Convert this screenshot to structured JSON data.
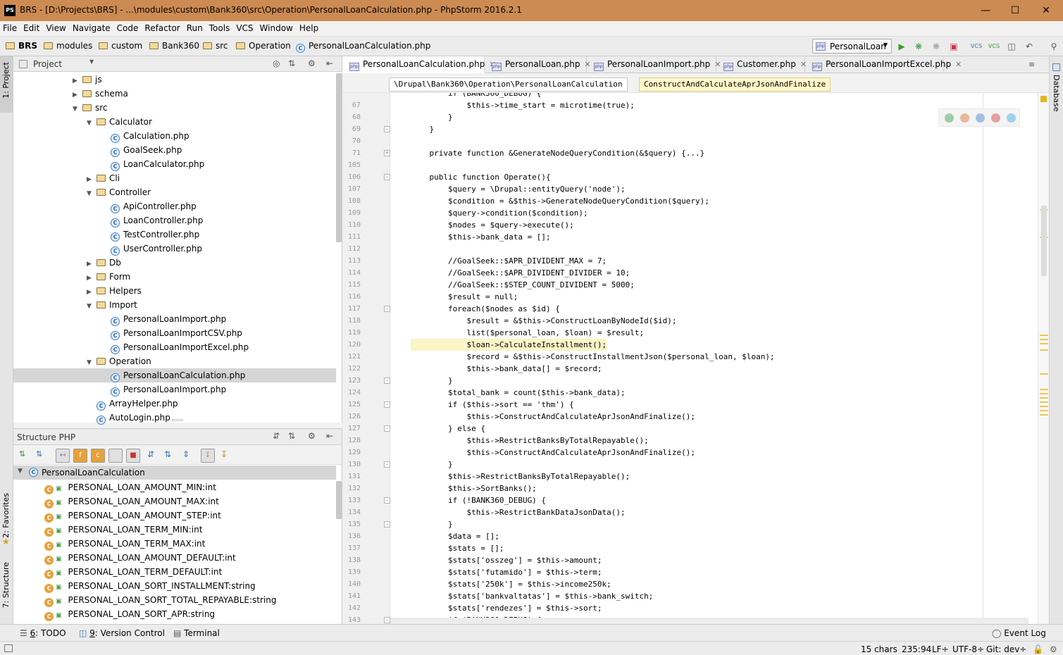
{
  "window": {
    "title": "BRS - [D:\\Projects\\BRS] - ...\\modules\\custom\\Bank360\\src\\Operation\\PersonalLoanCalculation.php - PhpStorm 2016.2.1",
    "logo": "PS"
  },
  "menu": [
    "File",
    "Edit",
    "View",
    "Navigate",
    "Code",
    "Refactor",
    "Run",
    "Tools",
    "VCS",
    "Window",
    "Help"
  ],
  "breadcrumbs": [
    "BRS",
    "modules",
    "custom",
    "Bank360",
    "src",
    "Operation",
    "PersonalLoanCalculation.php"
  ],
  "run_config": "PersonalLoan",
  "toolwindows": {
    "project": "1: Project",
    "favorites": "2: Favorites",
    "structure": "7: Structure",
    "database": "Database"
  },
  "project_panel": {
    "title": "Project",
    "rows": [
      {
        "label": "js",
        "type": "folder",
        "depth": 0,
        "arrow": "collapsed"
      },
      {
        "label": "schema",
        "type": "folder",
        "depth": 0,
        "arrow": "collapsed"
      },
      {
        "label": "src",
        "type": "folder",
        "depth": 0,
        "arrow": "expanded"
      },
      {
        "label": "Calculator",
        "type": "folder",
        "depth": 1,
        "arrow": "expanded"
      },
      {
        "label": "Calculation.php",
        "type": "class",
        "depth": 2
      },
      {
        "label": "GoalSeek.php",
        "type": "class",
        "depth": 2
      },
      {
        "label": "LoanCalculator.php",
        "type": "class",
        "depth": 2
      },
      {
        "label": "Cli",
        "type": "folder",
        "depth": 1,
        "arrow": "collapsed"
      },
      {
        "label": "Controller",
        "type": "folder",
        "depth": 1,
        "arrow": "expanded"
      },
      {
        "label": "ApiController.php",
        "type": "class",
        "depth": 2
      },
      {
        "label": "LoanController.php",
        "type": "class",
        "depth": 2
      },
      {
        "label": "TestController.php",
        "type": "class",
        "depth": 2
      },
      {
        "label": "UserController.php",
        "type": "class",
        "depth": 2
      },
      {
        "label": "Db",
        "type": "folder",
        "depth": 1,
        "arrow": "collapsed"
      },
      {
        "label": "Form",
        "type": "folder",
        "depth": 1,
        "arrow": "collapsed"
      },
      {
        "label": "Helpers",
        "type": "folder",
        "depth": 1,
        "arrow": "collapsed"
      },
      {
        "label": "Import",
        "type": "folder",
        "depth": 1,
        "arrow": "expanded"
      },
      {
        "label": "PersonalLoanImport.php",
        "type": "class",
        "depth": 2
      },
      {
        "label": "PersonalLoanImportCSV.php",
        "type": "class",
        "depth": 2
      },
      {
        "label": "PersonalLoanImportExcel.php",
        "type": "class",
        "depth": 2
      },
      {
        "label": "Operation",
        "type": "folder",
        "depth": 1,
        "arrow": "expanded"
      },
      {
        "label": "PersonalLoanCalculation.php",
        "type": "class",
        "depth": 2,
        "selected": true
      },
      {
        "label": "PersonalLoanImport.php",
        "type": "class",
        "depth": 2
      },
      {
        "label": "ArrayHelper.php",
        "type": "class",
        "depth": 1
      },
      {
        "label": "AutoLogin.php",
        "type": "class",
        "depth": 1
      }
    ]
  },
  "structure_panel": {
    "title": "Structure PHP",
    "root": "PersonalLoanCalculation",
    "items": [
      "PERSONAL_LOAN_AMOUNT_MIN:int",
      "PERSONAL_LOAN_AMOUNT_MAX:int",
      "PERSONAL_LOAN_AMOUNT_STEP:int",
      "PERSONAL_LOAN_TERM_MIN:int",
      "PERSONAL_LOAN_TERM_MAX:int",
      "PERSONAL_LOAN_AMOUNT_DEFAULT:int",
      "PERSONAL_LOAN_TERM_DEFAULT:int",
      "PERSONAL_LOAN_SORT_INSTALLMENT:string",
      "PERSONAL_LOAN_SORT_TOTAL_REPAYABLE:string",
      "PERSONAL_LOAN_SORT_APR:string"
    ]
  },
  "editor_tabs": [
    {
      "label": "PersonalLoanCalculation.php",
      "active": true
    },
    {
      "label": "PersonalLoan.php"
    },
    {
      "label": "PersonalLoanImport.php"
    },
    {
      "label": "Customer.php"
    },
    {
      "label": "PersonalLoanImportExcel.php"
    }
  ],
  "editor_crumbs": [
    "\\Drupal\\Bank360\\Operation\\PersonalLoanCalculation",
    "ConstructAndCalculateAprJsonAndFinalize"
  ],
  "code_lines": [
    {
      "n": "",
      "t": "        if (BANK360_DEBUG) {"
    },
    {
      "n": "67",
      "t": "            $this->time_start = microtime(true);"
    },
    {
      "n": "68",
      "t": "        }"
    },
    {
      "n": "69",
      "t": "    }"
    },
    {
      "n": "70",
      "t": ""
    },
    {
      "n": "71",
      "t": "    private function &GenerateNodeQueryCondition(&$query) {...}"
    },
    {
      "n": "105",
      "t": ""
    },
    {
      "n": "106",
      "t": "    public function Operate(){"
    },
    {
      "n": "107",
      "t": "        $query = \\Drupal::entityQuery('node');"
    },
    {
      "n": "108",
      "t": "        $condition = &$this->GenerateNodeQueryCondition($query);"
    },
    {
      "n": "109",
      "t": "        $query->condition($condition);"
    },
    {
      "n": "110",
      "t": "        $nodes = $query->execute();"
    },
    {
      "n": "111",
      "t": "        $this->bank_data = [];"
    },
    {
      "n": "112",
      "t": ""
    },
    {
      "n": "113",
      "t": "        //GoalSeek::$APR_DIVIDENT_MAX = 7;"
    },
    {
      "n": "114",
      "t": "        //GoalSeek::$APR_DIVIDENT_DIVIDER = 10;"
    },
    {
      "n": "115",
      "t": "        //GoalSeek::$STEP_COUNT_DIVIDENT = 5000;"
    },
    {
      "n": "116",
      "t": "        $result = null;"
    },
    {
      "n": "117",
      "t": "        foreach($nodes as $id) {"
    },
    {
      "n": "118",
      "t": "            $result = &$this->ConstructLoanByNodeId($id);"
    },
    {
      "n": "119",
      "t": "            list($personal_loan, $loan) = $result;"
    },
    {
      "n": "120",
      "t": "            $loan->CalculateInstallment();"
    },
    {
      "n": "121",
      "t": "            $record = &$this->ConstructInstallmentJson($personal_loan, $loan);"
    },
    {
      "n": "122",
      "t": "            $this->bank_data[] = $record;"
    },
    {
      "n": "123",
      "t": "        }"
    },
    {
      "n": "124",
      "t": "        $total_bank = count($this->bank_data);"
    },
    {
      "n": "125",
      "t": "        if ($this->sort == 'thm') {"
    },
    {
      "n": "126",
      "t": "            $this->ConstructAndCalculateAprJsonAndFinalize();"
    },
    {
      "n": "127",
      "t": "        } else {"
    },
    {
      "n": "128",
      "t": "            $this->RestrictBanksByTotalRepayable();"
    },
    {
      "n": "129",
      "t": "            $this->ConstructAndCalculateAprJsonAndFinalize();"
    },
    {
      "n": "130",
      "t": "        }"
    },
    {
      "n": "131",
      "t": "        $this->RestrictBanksByTotalRepayable();"
    },
    {
      "n": "132",
      "t": "        $this->SortBanks();"
    },
    {
      "n": "133",
      "t": "        if (!BANK360_DEBUG) {"
    },
    {
      "n": "134",
      "t": "            $this->RestrictBankDataJsonData();"
    },
    {
      "n": "135",
      "t": "        }"
    },
    {
      "n": "136",
      "t": "        $data = [];"
    },
    {
      "n": "137",
      "t": "        $stats = [];"
    },
    {
      "n": "138",
      "t": "        $stats['osszeg'] = $this->amount;"
    },
    {
      "n": "139",
      "t": "        $stats['futamido'] = $this->term;"
    },
    {
      "n": "140",
      "t": "        $stats['250k'] = $this->income250k;"
    },
    {
      "n": "141",
      "t": "        $stats['bankvaltatas'] = $this->bank_switch;"
    },
    {
      "n": "142",
      "t": "        $stats['rendezes'] = $this->sort;"
    },
    {
      "n": "143",
      "t": "        if (BANK360_DEBUG) {"
    }
  ],
  "bottom_tools": {
    "todo_num": "6",
    "todo": ": TODO",
    "vc_num": "9",
    "vc": ": Version Control",
    "terminal": "Terminal",
    "event_log": "Event Log"
  },
  "status": {
    "chars": "15 chars",
    "pos": "235:94",
    "lf": "LF÷",
    "enc": "UTF-8÷",
    "git": "Git: dev÷"
  }
}
